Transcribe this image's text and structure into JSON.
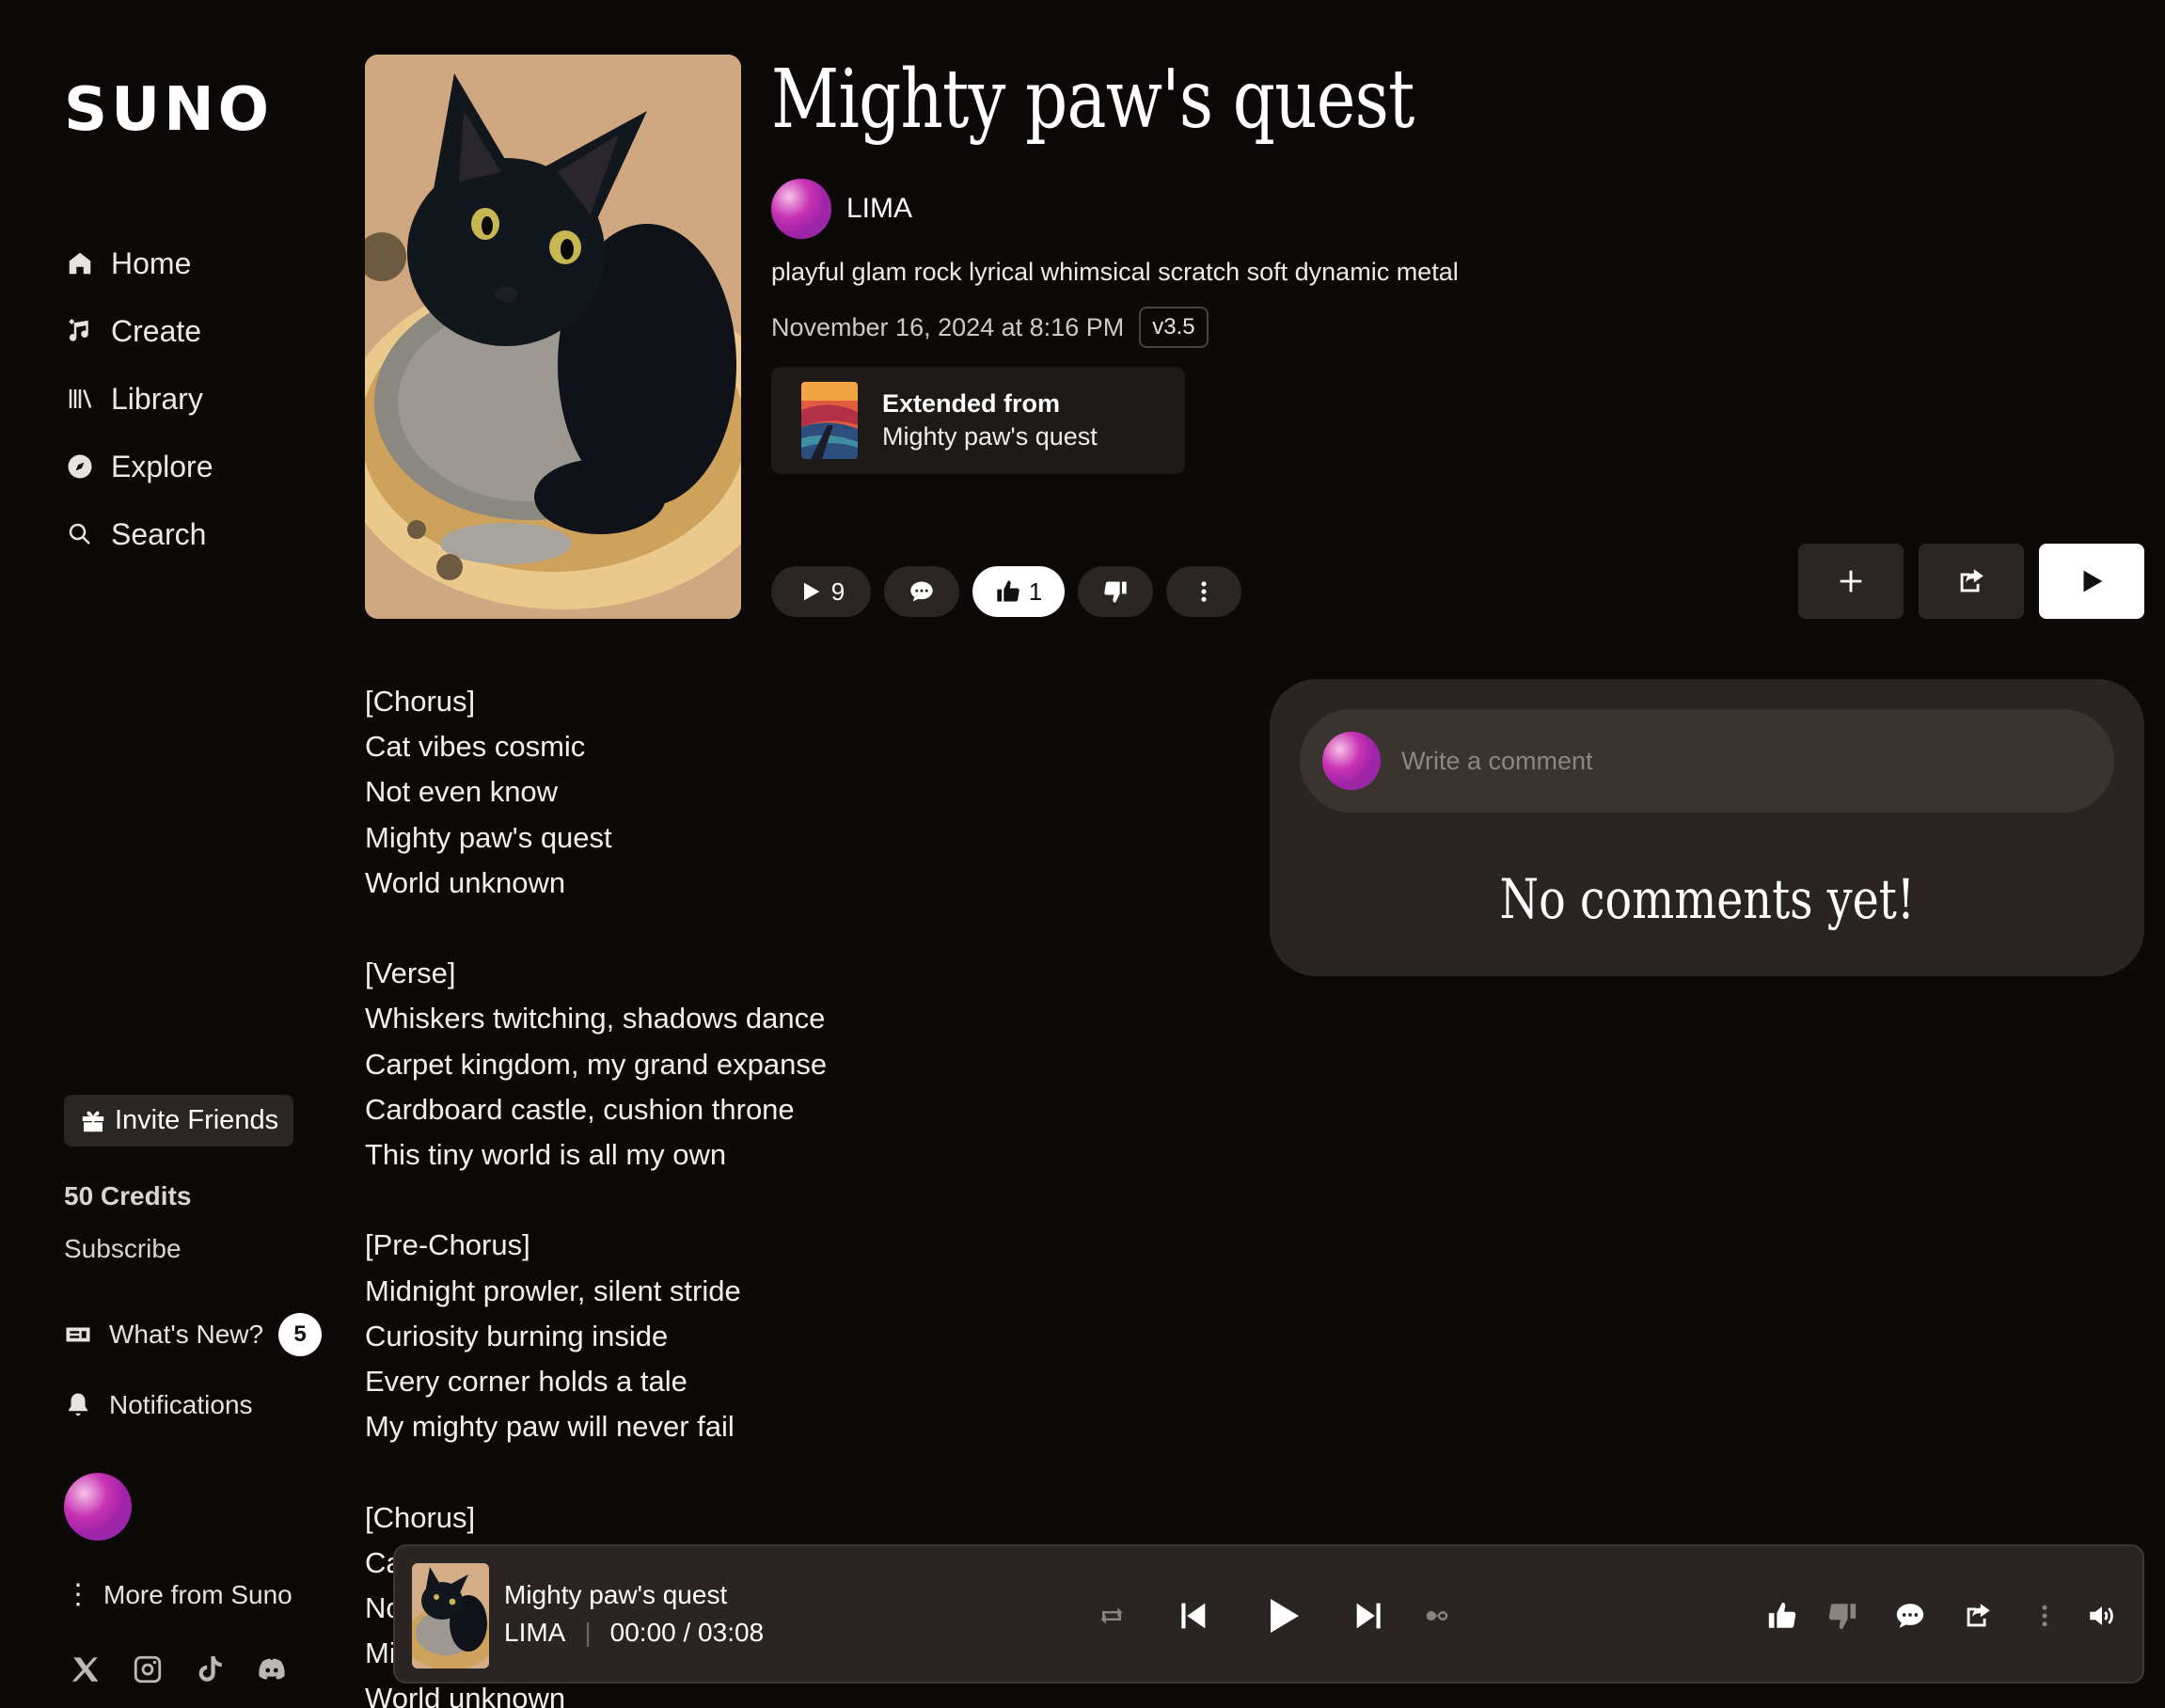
{
  "sidebar": {
    "logo": "SUNO",
    "nav": [
      {
        "label": "Home",
        "icon": "home-icon"
      },
      {
        "label": "Create",
        "icon": "music-note-icon"
      },
      {
        "label": "Library",
        "icon": "library-icon"
      },
      {
        "label": "Explore",
        "icon": "compass-icon"
      },
      {
        "label": "Search",
        "icon": "search-icon"
      }
    ],
    "invite_label": "Invite Friends",
    "credits": "50 Credits",
    "subscribe": "Subscribe",
    "whats_new": "What's New?",
    "whats_new_count": "5",
    "notifications": "Notifications",
    "more": "More from Suno",
    "socials": [
      "x-icon",
      "instagram-icon",
      "tiktok-icon",
      "discord-icon"
    ]
  },
  "song": {
    "title": "Mighty paw's quest",
    "artist": "LIMA",
    "tags": "playful glam rock lyrical whimsical scratch soft dynamic metal",
    "date": "November 16, 2024 at 8:16 PM",
    "version": "v3.5",
    "extended_label": "Extended from",
    "extended_title": "Mighty paw's quest",
    "play_count": "9",
    "like_count": "1",
    "lyrics": "[Chorus]\nCat vibes cosmic\nNot even know\nMighty paw's quest\nWorld unknown\n\n[Verse]\nWhiskers twitching, shadows dance\nCarpet kingdom, my grand expanse\nCardboard castle, cushion throne\nThis tiny world is all my own\n\n[Pre-Chorus]\nMidnight prowler, silent stride\nCuriosity burning inside\nEvery corner holds a tale\nMy mighty paw will never fail\n\n[Chorus]\nCat vibes cosmic\nNot even know\nMighty paw's quest\nWorld unknown"
  },
  "comments": {
    "placeholder": "Write a comment",
    "empty": "No comments yet!"
  },
  "player": {
    "title": "Mighty paw's quest",
    "artist": "LIMA",
    "time": "00:00 / 03:08"
  },
  "colors": {
    "background": "#0d0908",
    "panel": "#2a2523",
    "button": "#2b2624",
    "avatar_accent": "#c832b4"
  }
}
